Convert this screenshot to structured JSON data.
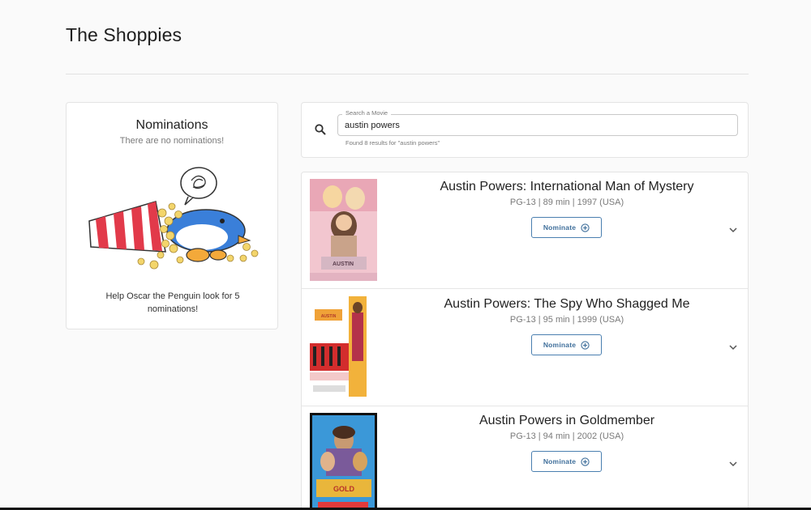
{
  "app": {
    "title": "The Shoppies"
  },
  "nominations": {
    "title": "Nominations",
    "empty_text": "There are no nominations!",
    "help_text": "Help Oscar the Penguin look for 5 nominations!"
  },
  "search": {
    "label": "Search a Movie",
    "value": "austin powers",
    "helper_text": "Found 8 results for \"austin powers\""
  },
  "results": [
    {
      "title": "Austin Powers: International Man of Mystery",
      "meta": "PG-13 | 89 min | 1997 (USA)",
      "nominate_label": "Nominate"
    },
    {
      "title": "Austin Powers: The Spy Who Shagged Me",
      "meta": "PG-13 | 95 min | 1999 (USA)",
      "nominate_label": "Nominate"
    },
    {
      "title": "Austin Powers in Goldmember",
      "meta": "PG-13 | 94 min | 2002 (USA)",
      "nominate_label": "Nominate"
    }
  ],
  "colors": {
    "accent": "#3f6f9b",
    "background": "#fafafa",
    "card": "#ffffff"
  }
}
